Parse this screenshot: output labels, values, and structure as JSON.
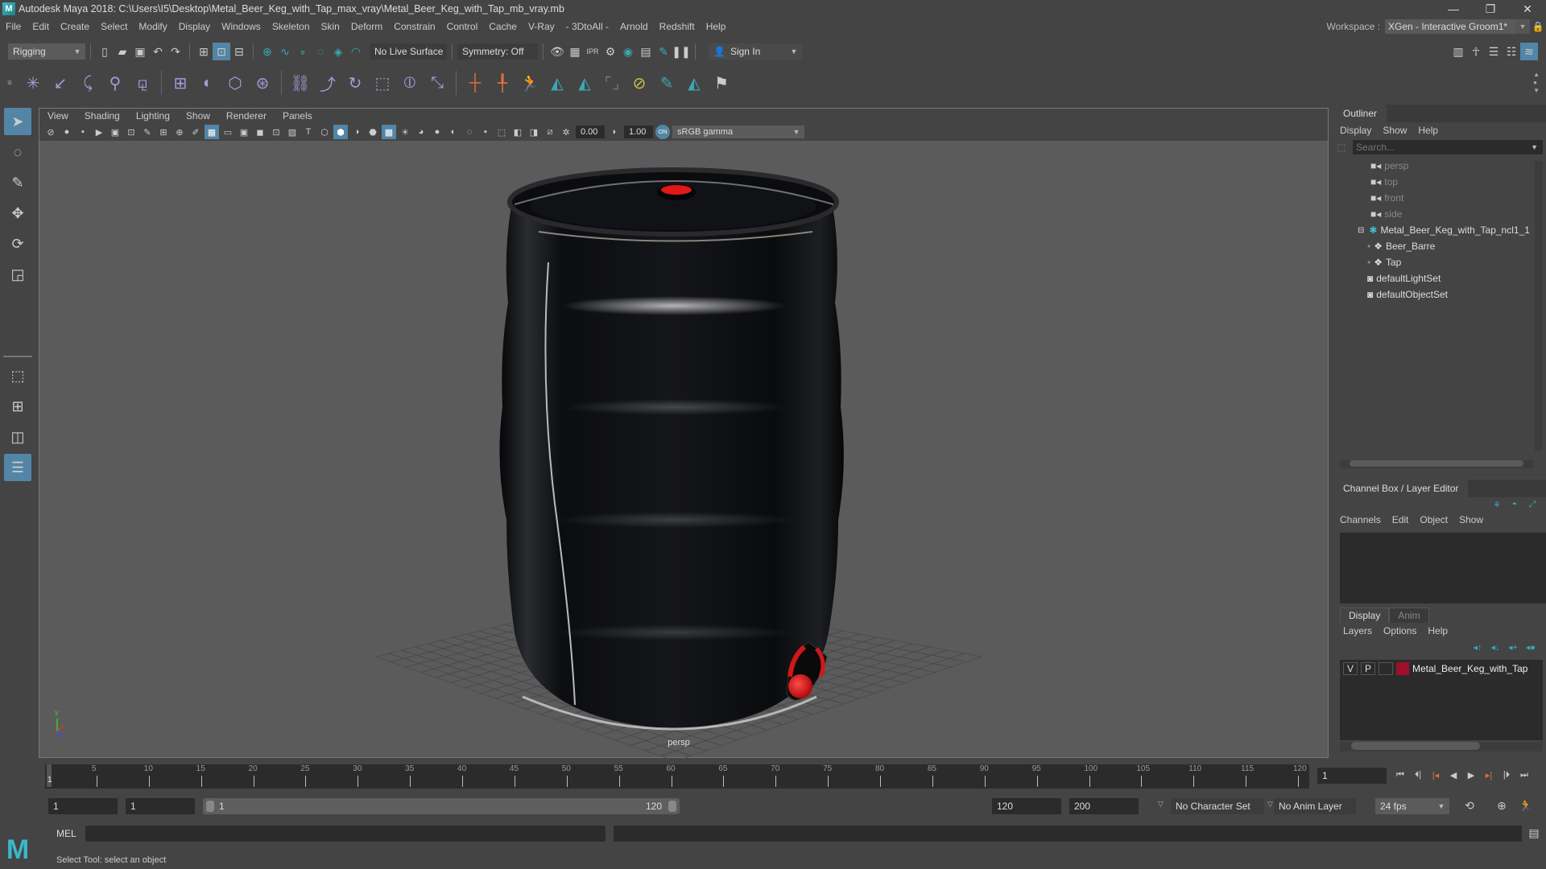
{
  "window": {
    "title": "Autodesk Maya 2018: C:\\Users\\I5\\Desktop\\Metal_Beer_Keg_with_Tap_max_vray\\Metal_Beer_Keg_with_Tap_mb_vray.mb",
    "logo": "M",
    "minimize": "—",
    "restore": "❐",
    "close": "✕"
  },
  "menubar": [
    "File",
    "Edit",
    "Create",
    "Select",
    "Modify",
    "Display",
    "Windows",
    "Skeleton",
    "Skin",
    "Deform",
    "Constrain",
    "Control",
    "Cache",
    "V-Ray",
    "- 3DtoAll -",
    "Arnold",
    "Redshift",
    "Help"
  ],
  "workspace": {
    "label": "Workspace :",
    "value": "XGen - Interactive Groom1*"
  },
  "statusline": {
    "menuset": "Rigging",
    "live_surface": "No Live Surface",
    "symmetry": "Symmetry: Off",
    "sign_in": "Sign In"
  },
  "viewport": {
    "menu": [
      "View",
      "Shading",
      "Lighting",
      "Show",
      "Renderer",
      "Panels"
    ],
    "exposure": "0.00",
    "gamma": "1.00",
    "color_space": "sRGB gamma",
    "camera_label": "persp",
    "axis": {
      "y": "y",
      "x": "x",
      "z": "z"
    }
  },
  "outliner": {
    "title": "Outliner",
    "menu": [
      "Display",
      "Show",
      "Help"
    ],
    "search_placeholder": "Search...",
    "items": [
      {
        "label": "persp",
        "type": "camera",
        "indent": 1,
        "dim": true
      },
      {
        "label": "top",
        "type": "camera",
        "indent": 1,
        "dim": true
      },
      {
        "label": "front",
        "type": "camera",
        "indent": 1,
        "dim": true
      },
      {
        "label": "side",
        "type": "camera",
        "indent": 1,
        "dim": true
      },
      {
        "label": "Metal_Beer_Keg_with_Tap_ncl1_1",
        "type": "group",
        "indent": 0,
        "expanded": true
      },
      {
        "label": "Beer_Barre",
        "type": "mesh",
        "indent": 2
      },
      {
        "label": "Tap",
        "type": "mesh",
        "indent": 2
      },
      {
        "label": "defaultLightSet",
        "type": "set",
        "indent": 1
      },
      {
        "label": "defaultObjectSet",
        "type": "set",
        "indent": 1
      }
    ]
  },
  "channel_box": {
    "title": "Channel Box / Layer Editor",
    "menu": [
      "Channels",
      "Edit",
      "Object",
      "Show"
    ]
  },
  "layer_editor": {
    "tabs": [
      "Display",
      "Anim"
    ],
    "active_tab": "Display",
    "menu": [
      "Layers",
      "Options",
      "Help"
    ],
    "layers": [
      {
        "v": "V",
        "p": "P",
        "color": "#a0102a",
        "name": "Metal_Beer_Keg_with_Tap"
      }
    ]
  },
  "timeline": {
    "ticks": [
      "5",
      "10",
      "15",
      "20",
      "25",
      "30",
      "35",
      "40",
      "45",
      "50",
      "55",
      "60",
      "65",
      "70",
      "75",
      "80",
      "85",
      "90",
      "95",
      "100",
      "105",
      "110",
      "115",
      "120"
    ],
    "current_frame_marker": "1",
    "current_frame": "1"
  },
  "range": {
    "start": "1",
    "playback_start": "1",
    "slider_start": "1",
    "slider_end": "120",
    "playback_end": "120",
    "end": "200",
    "character_set": "No Character Set",
    "anim_layer": "No Anim Layer",
    "fps": "24 fps"
  },
  "command_line": {
    "label": "MEL"
  },
  "help_line": "Select Tool: select an object",
  "colors": {
    "accent": "#5285a6",
    "teal": "#3aa8b4",
    "layer_red": "#a0102a",
    "keg_red": "#e01818"
  }
}
